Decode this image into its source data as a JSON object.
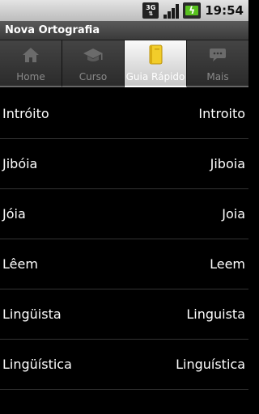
{
  "status_bar": {
    "network": "3G",
    "time": "19:54"
  },
  "app_title": "Nova Ortografia",
  "tabs": [
    {
      "label": "Home",
      "icon": "home-icon"
    },
    {
      "label": "Curso",
      "icon": "graduation-cap-icon"
    },
    {
      "label": "Guia Rápido",
      "icon": "notebook-icon",
      "active": true
    },
    {
      "label": "Mais",
      "icon": "speech-bubble-icon"
    }
  ],
  "rows": [
    {
      "old": "Intróito",
      "new": "Introito"
    },
    {
      "old": "Jibóia",
      "new": "Jiboia"
    },
    {
      "old": "Jóia",
      "new": "Joia"
    },
    {
      "old": "Lêem",
      "new": "Leem"
    },
    {
      "old": "Lingüista",
      "new": "Linguista"
    },
    {
      "old": "Lingüística",
      "new": "Linguística"
    }
  ],
  "colors": {
    "active_tab_icon": "#f2cd2a",
    "battery_fill": "#58c11f"
  }
}
